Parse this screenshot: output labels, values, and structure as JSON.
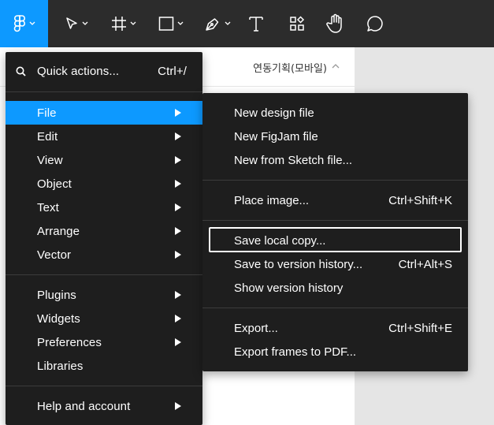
{
  "toolbar": {
    "icons": [
      "figma-logo-icon",
      "move-tool-icon",
      "frame-tool-icon",
      "shape-tool-icon",
      "pen-tool-icon",
      "text-tool-icon",
      "resources-icon",
      "hand-tool-icon",
      "comment-icon"
    ],
    "accent": "#0d99ff",
    "background": "#2c2c2c"
  },
  "page": {
    "name": "연동기획(모바일)"
  },
  "main_menu": {
    "quick_actions": {
      "label": "Quick actions...",
      "shortcut": "Ctrl+/"
    },
    "group1": [
      {
        "label": "File",
        "has_submenu": true,
        "highlighted": true
      },
      {
        "label": "Edit",
        "has_submenu": true
      },
      {
        "label": "View",
        "has_submenu": true
      },
      {
        "label": "Object",
        "has_submenu": true
      },
      {
        "label": "Text",
        "has_submenu": true
      },
      {
        "label": "Arrange",
        "has_submenu": true
      },
      {
        "label": "Vector",
        "has_submenu": true
      }
    ],
    "group2": [
      {
        "label": "Plugins",
        "has_submenu": true
      },
      {
        "label": "Widgets",
        "has_submenu": true
      },
      {
        "label": "Preferences",
        "has_submenu": true
      },
      {
        "label": "Libraries",
        "has_submenu": false
      }
    ],
    "group3": [
      {
        "label": "Help and account",
        "has_submenu": true
      }
    ]
  },
  "file_menu": {
    "group1": [
      {
        "label": "New design file",
        "shortcut": ""
      },
      {
        "label": "New FigJam file",
        "shortcut": ""
      },
      {
        "label": "New from Sketch file...",
        "shortcut": ""
      }
    ],
    "group2": [
      {
        "label": "Place image...",
        "shortcut": "Ctrl+Shift+K"
      }
    ],
    "group3": [
      {
        "label": "Save local copy...",
        "shortcut": "",
        "focused": true
      },
      {
        "label": "Save to version history...",
        "shortcut": "Ctrl+Alt+S"
      },
      {
        "label": "Show version history",
        "shortcut": ""
      }
    ],
    "group4": [
      {
        "label": "Export...",
        "shortcut": "Ctrl+Shift+E"
      },
      {
        "label": "Export frames to PDF...",
        "shortcut": ""
      }
    ]
  }
}
